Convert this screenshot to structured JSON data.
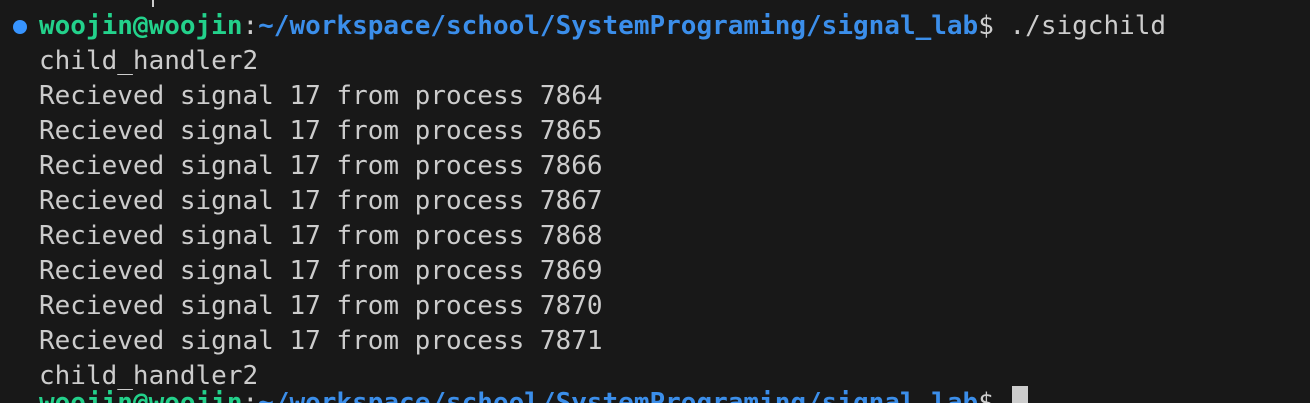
{
  "prompt": {
    "user_host": "woojin@woojin",
    "separator": ":",
    "path": "~/workspace/school/SystemPrograming/signal_lab",
    "symbol": "$ ",
    "command": "./sigchild"
  },
  "output": [
    "child_handler2",
    "Recieved signal 17 from process 7864",
    "Recieved signal 17 from process 7865",
    "Recieved signal 17 from process 7866",
    "Recieved signal 17 from process 7867",
    "Recieved signal 17 from process 7868",
    "Recieved signal 17 from process 7869",
    "Recieved signal 17 from process 7870",
    "Recieved signal 17 from process 7871",
    "child_handler2"
  ],
  "next_prompt": {
    "user_host": "woojin@woojin",
    "separator": ":",
    "path": "~/workspace/school/SystemPrograming/signal_lab",
    "symbol": "$ "
  },
  "colors": {
    "background": "#181818",
    "text": "#cccccc",
    "user_host": "#23d18b",
    "path": "#3b8eea",
    "status_dot": "#3794ff"
  }
}
